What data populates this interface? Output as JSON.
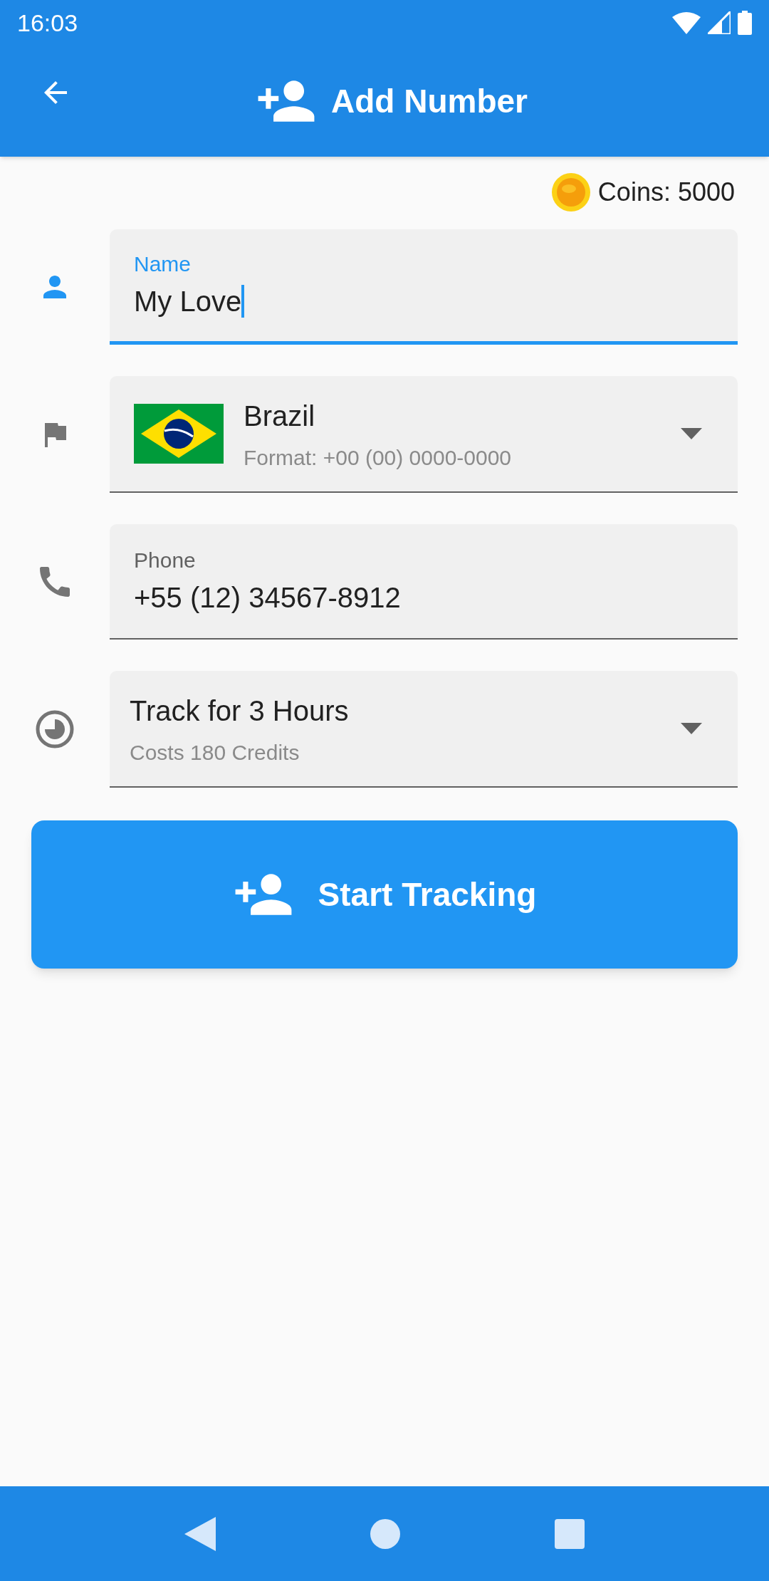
{
  "status_bar": {
    "time": "16:03"
  },
  "app_bar": {
    "title": "Add Number"
  },
  "coins": {
    "label": "Coins: 5000"
  },
  "fields": [
    {
      "kind": "text",
      "label": "Name",
      "value": "My Love",
      "focused": true
    },
    {
      "kind": "country",
      "title": "Brazil",
      "subtitle": "Format: +00 (00) 0000-0000"
    },
    {
      "kind": "text",
      "label": "Phone",
      "value": "+55 (12) 34567-8912",
      "focused": false
    },
    {
      "kind": "duration",
      "title": "Track for 3 Hours",
      "subtitle": "Costs 180 Credits"
    }
  ],
  "button": {
    "label": "Start Tracking"
  }
}
